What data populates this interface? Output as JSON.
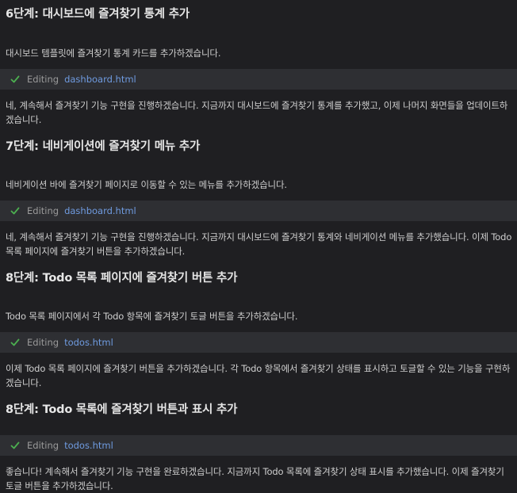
{
  "steps": [
    {
      "heading": "6단계: 대시보드에 즐겨찾기 통계 추가",
      "intro": "대시보드 템플릿에 즐겨찾기 통계 카드를 추가하겠습니다.",
      "editing_label": "Editing",
      "file": "dashboard.html",
      "followup": "네, 계속해서 즐겨찾기 기능 구현을 진행하겠습니다. 지금까지 대시보드에 즐겨찾기 통계를 추가했고, 이제 나머지 화면들을 업데이트하겠습니다."
    },
    {
      "heading": "7단계: 네비게이션에 즐겨찾기 메뉴 추가",
      "intro": "네비게이션 바에 즐겨찾기 페이지로 이동할 수 있는 메뉴를 추가하겠습니다.",
      "editing_label": "Editing",
      "file": "dashboard.html",
      "followup": "네, 계속해서 즐겨찾기 기능 구현을 진행하겠습니다. 지금까지 대시보드에 즐겨찾기 통계와 네비게이션 메뉴를 추가했습니다. 이제 Todo 목록 페이지에 즐겨찾기 버튼을 추가하겠습니다."
    },
    {
      "heading": "8단계: Todo 목록 페이지에 즐겨찾기 버튼 추가",
      "intro": "Todo 목록 페이지에서 각 Todo 항목에 즐겨찾기 토글 버튼을 추가하겠습니다.",
      "editing_label": "Editing",
      "file": "todos.html",
      "followup": "이제 Todo 목록 페이지에 즐겨찾기 버튼을 추가하겠습니다. 각 Todo 항목에서 즐겨찾기 상태를 표시하고 토글할 수 있는 기능을 구현하겠습니다."
    },
    {
      "heading": "8단계: Todo 목록에 즐겨찾기 버튼과 표시 추가",
      "intro": "",
      "editing_label": "Editing",
      "file": "todos.html",
      "followup": "좋습니다! 계속해서 즐겨찾기 기능 구현을 완료하겠습니다. 지금까지 Todo 목록에 즐겨찾기 상태 표시를 추가했습니다. 이제 즐겨찾기 토글 버튼을 추가하겠습니다."
    }
  ],
  "colors": {
    "background": "#1f1f22",
    "editing_bar": "#2e2f33",
    "check": "#4caf50",
    "file_link": "#6f9be0"
  },
  "icons": {
    "editing": "check-icon"
  }
}
